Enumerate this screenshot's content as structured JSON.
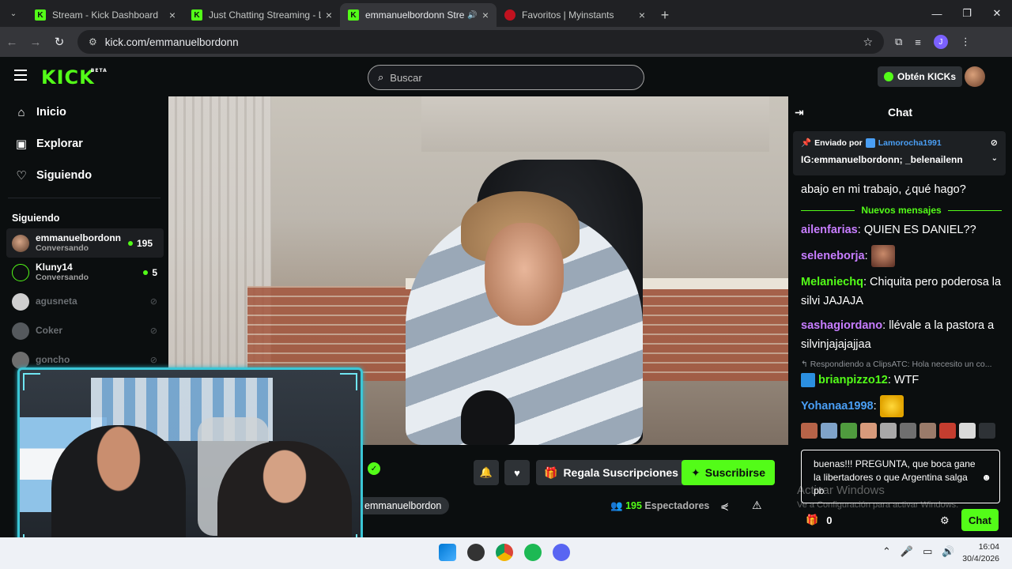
{
  "browser": {
    "tabs": [
      {
        "title": "Stream - Kick Dashboard",
        "favicon": "kick-icon",
        "active": false
      },
      {
        "title": "Just Chatting Streaming - Live S",
        "favicon": "kick-icon",
        "active": false
      },
      {
        "title": "emmanuelbordonn Stream",
        "favicon": "kick-icon",
        "active": true
      },
      {
        "title": "Favoritos | Myinstants",
        "favicon": "myinstants-icon",
        "active": false
      }
    ],
    "url": "kick.com/emmanuelbordonn"
  },
  "header": {
    "logo": "KICK",
    "logo_badge": "BETA",
    "search_placeholder": "Buscar",
    "get_kicks": "Obtén KICKs"
  },
  "sidebar": {
    "nav": [
      {
        "label": "Inicio",
        "icon": "home-icon"
      },
      {
        "label": "Explorar",
        "icon": "explore-icon"
      },
      {
        "label": "Siguiendo",
        "icon": "heart-icon"
      }
    ],
    "following_title": "Siguiendo",
    "channels": [
      {
        "name": "emmanuelbordonn",
        "category": "Conversando",
        "viewers": "195",
        "live": true
      },
      {
        "name": "Kluny14",
        "category": "Conversando",
        "viewers": "5",
        "live": true
      },
      {
        "name": "agusneta",
        "live": false
      },
      {
        "name": "Coker",
        "live": false
      },
      {
        "name": "goncho",
        "live": false
      }
    ]
  },
  "stream": {
    "gift_subs": "Regala Suscripciones",
    "subscribe": "Suscribirse",
    "channel_tag": "emmanuelbordon",
    "viewers": "195",
    "viewers_label": "Espectadores"
  },
  "chat": {
    "title": "Chat",
    "pinned": {
      "sent_by": "Enviado por",
      "user": "Lamorocha1991",
      "message": "IG:emmanuelbordonn; _belenailenn"
    },
    "partial_message": "abajo en mi trabajo, ¿qué hago?",
    "new_messages": "Nuevos mensajes",
    "messages": [
      {
        "user": "ailenfarias",
        "color": "#c77dff",
        "text": "QUIEN ES DANIEL??"
      },
      {
        "user": "seleneborja",
        "color": "#c77dff",
        "text": ""
      },
      {
        "user": "Melaniechq",
        "color": "#53fc18",
        "text": "Chiquita pero poderosa la silvi JAJAJA"
      },
      {
        "user": "sashagiordano",
        "color": "#c77dff",
        "text": "llévale a la pastora a silvinjajajajjaa"
      },
      {
        "user": "brianpizzo12",
        "color": "#53fc18",
        "text": "WTF",
        "reply": "Respondiendo a ClipsATC: Hola necesito un co..."
      },
      {
        "user": "Yohanaa1998",
        "color": "#4a9ff5",
        "text": ""
      }
    ],
    "input_text": "buenas!!! PREGUNTA, que boca gane la libertadores o que Argentina salga pb",
    "gift_count": "0",
    "send_label": "Chat"
  },
  "watermark": {
    "line1": "Activar Windows",
    "line2": "Ve a Configuración para activar Windows."
  },
  "taskbar": {
    "time": "16:04",
    "date": "30/4/2026"
  },
  "colors": {
    "kick_green": "#53fc18",
    "background": "#0b0e0f",
    "cam_frame": "#3bc6d6"
  }
}
